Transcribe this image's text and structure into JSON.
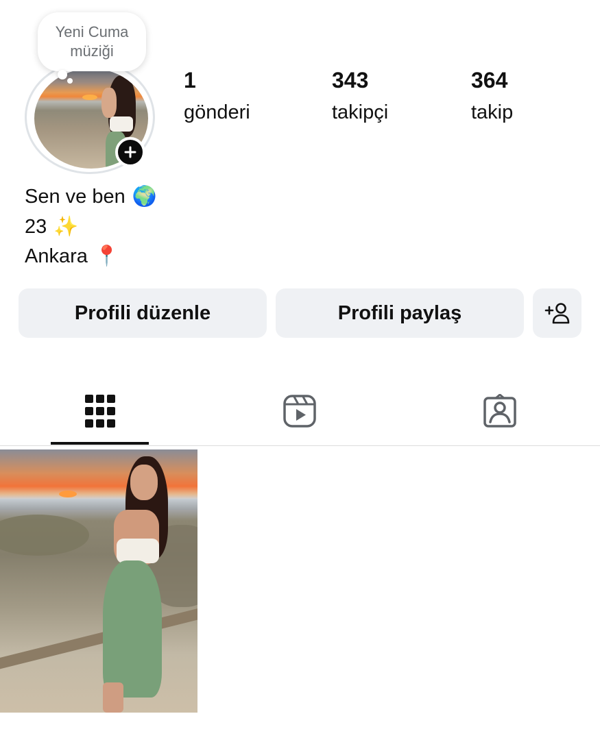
{
  "music_note": {
    "text": "Yeni Cuma müziği"
  },
  "stats": [
    {
      "value": "1",
      "label": "gönderi"
    },
    {
      "value": "343",
      "label": "takipçi"
    },
    {
      "value": "364",
      "label": "takip"
    }
  ],
  "bio": [
    {
      "text": "Sen ve ben",
      "emoji": "🌍"
    },
    {
      "text": "23",
      "emoji": "✨"
    },
    {
      "text": "Ankara",
      "emoji": "📍"
    }
  ],
  "actions": {
    "edit_profile": "Profili düzenle",
    "share_profile": "Profili paylaş",
    "discover_people_icon": "person-add-icon"
  },
  "tabs": [
    {
      "icon": "grid-icon",
      "active": true
    },
    {
      "icon": "reels-icon",
      "active": false
    },
    {
      "icon": "tagged-icon",
      "active": false
    }
  ],
  "colors": {
    "button_bg": "#eff1f4",
    "text": "#111111",
    "muted_text": "#6b6f73",
    "icon_inactive": "#5f6368"
  }
}
